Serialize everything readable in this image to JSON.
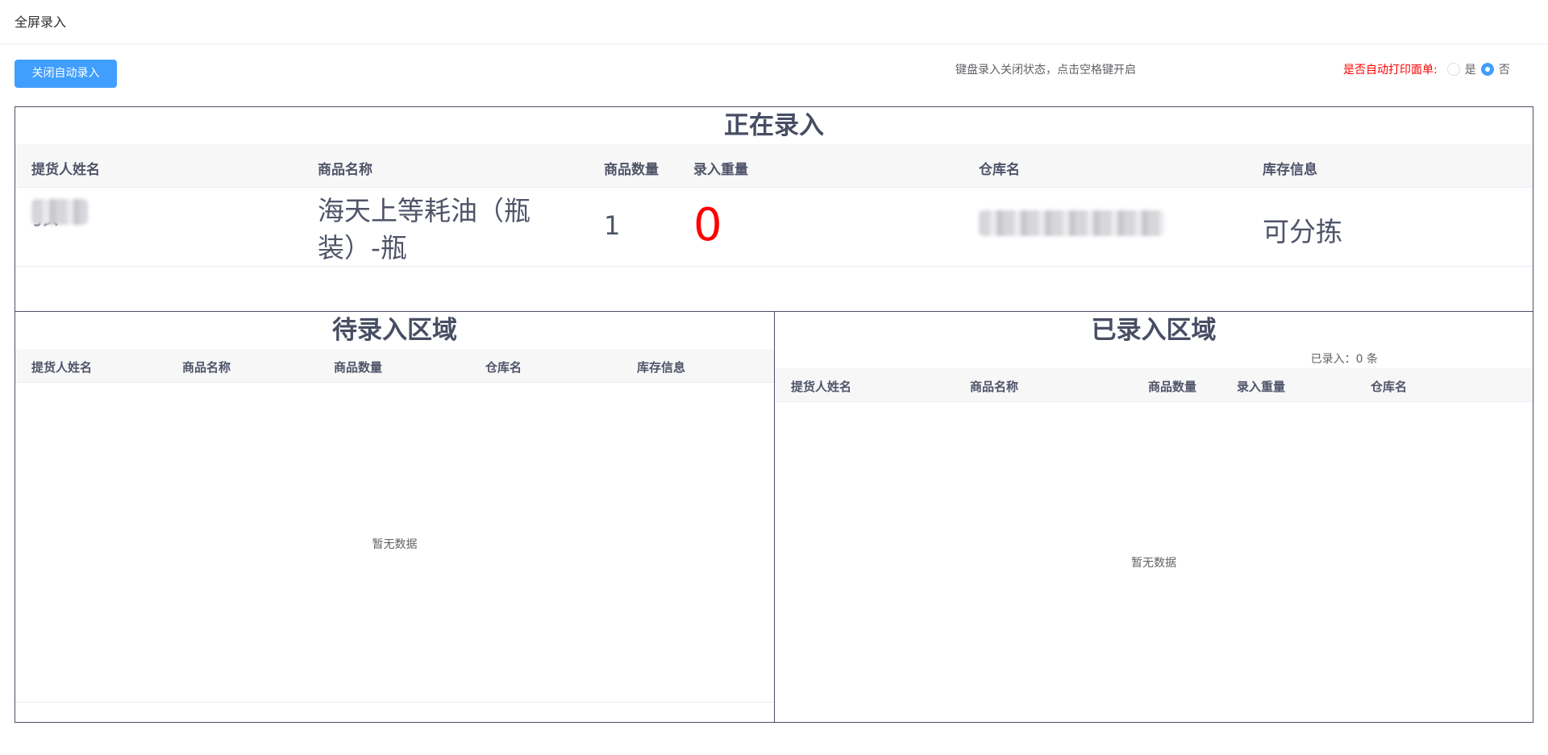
{
  "header": {
    "title": "全屏录入"
  },
  "toolbar": {
    "auto_button": "关闭自动录入",
    "keyboard_status": "键盘录入关闭状态，点击空格键开启",
    "print_label": "是否自动打印面单:",
    "print_options": [
      "是",
      "否"
    ],
    "print_selected": "否"
  },
  "current": {
    "title": "正在录入",
    "columns": [
      "提货人姓名",
      "商品名称",
      "商品数量",
      "录入重量",
      "仓库名",
      "库存信息"
    ],
    "row": {
      "name_visible": "张",
      "product": "海天上等耗油（瓶装）-瓶",
      "quantity": "1",
      "weight": "0",
      "stock": "可分拣"
    }
  },
  "pending": {
    "title": "待录入区域",
    "columns": [
      "提货人姓名",
      "商品名称",
      "商品数量",
      "仓库名",
      "库存信息"
    ],
    "empty_text": "暂无数据"
  },
  "entered": {
    "title": "已录入区域",
    "count_text": "已录入：0 条",
    "columns": [
      "提货人姓名",
      "商品名称",
      "商品数量",
      "录入重量",
      "仓库名"
    ],
    "empty_text": "暂无数据"
  },
  "colors": {
    "primary": "#409eff",
    "danger": "#ff0000",
    "border": "#4a5068"
  }
}
